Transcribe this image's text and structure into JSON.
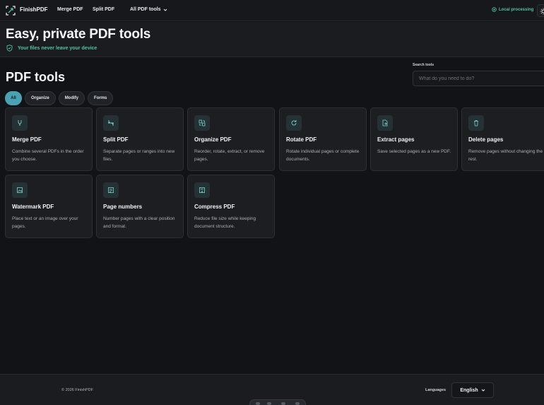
{
  "header": {
    "brand": "FinishPDF",
    "nav": {
      "merge": "Merge PDF",
      "split": "Split PDF",
      "all_tools": "All PDF tools"
    },
    "local_processing": "Local processing"
  },
  "hero": {
    "title": "Easy, private PDF tools",
    "subtitle": "Your files never leave your device"
  },
  "main": {
    "title": "PDF tools",
    "search": {
      "label": "Search tools",
      "placeholder": "What do you need to do?"
    },
    "filters": [
      "All",
      "Organize",
      "Modify",
      "Forms"
    ],
    "active_filter": "All",
    "tools": [
      {
        "title": "Merge PDF",
        "desc": "Combine several PDFs in the order you choose.",
        "icon": "merge-icon"
      },
      {
        "title": "Split PDF",
        "desc": "Separate pages or ranges into new files.",
        "icon": "split-icon"
      },
      {
        "title": "Organize PDF",
        "desc": "Reorder, rotate, extract, or remove pages.",
        "icon": "organize-icon"
      },
      {
        "title": "Rotate PDF",
        "desc": "Rotate individual pages or complete documents.",
        "icon": "rotate-icon"
      },
      {
        "title": "Extract pages",
        "desc": "Save selected pages as a new PDF.",
        "icon": "extract-icon"
      },
      {
        "title": "Delete pages",
        "desc": "Remove pages without changing the rest.",
        "icon": "trash-icon"
      },
      {
        "title": "Watermark PDF",
        "desc": "Place text or an image over your pages.",
        "icon": "watermark-icon"
      },
      {
        "title": "Page numbers",
        "desc": "Number pages with a clear position and format.",
        "icon": "page-numbers-icon"
      },
      {
        "title": "Compress PDF",
        "desc": "Reduce file size while keeping document structure.",
        "icon": "compress-icon"
      }
    ]
  },
  "footer": {
    "copyright": "© 2026 FinishPDF",
    "languages_label": "Languages",
    "language": "English"
  },
  "colors": {
    "accent": "#4fc3a1",
    "chip_active": "#4aa3b5",
    "background": "#121316",
    "card": "#1c1e22"
  }
}
